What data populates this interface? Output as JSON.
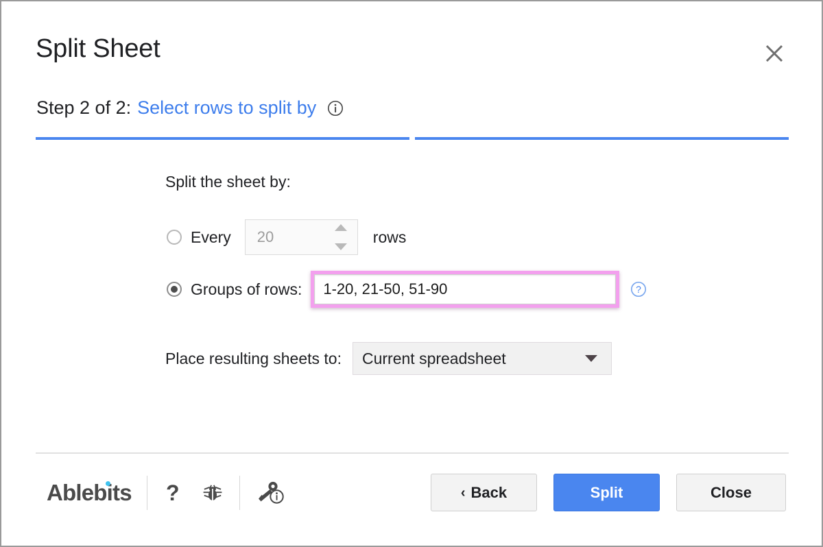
{
  "dialog": {
    "title": "Split Sheet",
    "close_icon": "close-x-icon"
  },
  "step": {
    "prefix": "Step 2 of 2:",
    "link": "Select rows to split by",
    "info_icon": "info-circle-icon",
    "progress_total": 2,
    "progress_current": 2
  },
  "form": {
    "split_by_label": "Split the sheet by:",
    "every": {
      "label": "Every",
      "value": "20",
      "suffix": "rows",
      "selected": false,
      "disabled": true
    },
    "groups": {
      "label": "Groups of rows:",
      "value": "1-20, 21-50, 51-90",
      "placeholder": "",
      "selected": true,
      "help_icon": "question-circle-icon",
      "highlight_color": "#f3a0ee"
    },
    "place": {
      "label": "Place resulting sheets to:",
      "selected": "Current spreadsheet",
      "options": [
        "Current spreadsheet"
      ]
    }
  },
  "footer": {
    "brand": "Ablebits",
    "brand_dot_color": "#3ec2ef",
    "icons": [
      {
        "name": "help-question-icon",
        "glyph": "?"
      },
      {
        "name": "report-bug-icon",
        "glyph": "bug"
      },
      {
        "name": "license-info-icon",
        "glyph": "key-info"
      }
    ],
    "buttons": {
      "back": "Back",
      "back_chevron": "‹",
      "split": "Split",
      "close": "Close"
    }
  },
  "colors": {
    "accent_blue": "#4a86ef",
    "link_blue": "#3d7dec",
    "highlight_pink": "#f3a0ee",
    "window_border": "#9a9a9a"
  }
}
